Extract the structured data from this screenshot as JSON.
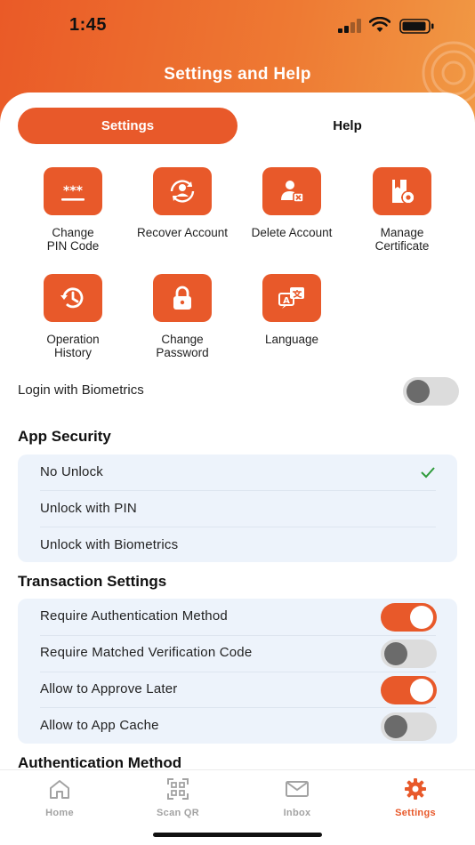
{
  "status_bar": {
    "time": "1:45"
  },
  "header": {
    "title": "Settings and Help"
  },
  "segments": {
    "settings": "Settings",
    "help": "Help"
  },
  "tiles": [
    {
      "label": "Change\nPIN Code",
      "icon": "pin-code-icon"
    },
    {
      "label": "Recover Account",
      "icon": "recover-account-icon"
    },
    {
      "label": "Delete Account",
      "icon": "delete-account-icon"
    },
    {
      "label": "Manage\nCertificate",
      "icon": "certificate-icon"
    },
    {
      "label": "Operation\nHistory",
      "icon": "history-icon"
    },
    {
      "label": "Change\nPassword",
      "icon": "lock-icon"
    },
    {
      "label": "Language",
      "icon": "language-icon"
    }
  ],
  "biometrics": {
    "label": "Login with Biometrics",
    "enabled": false
  },
  "app_security": {
    "title": "App Security",
    "options": [
      {
        "label": "No Unlock",
        "selected": true
      },
      {
        "label": "Unlock with PIN",
        "selected": false
      },
      {
        "label": "Unlock with Biometrics",
        "selected": false
      }
    ]
  },
  "transaction_settings": {
    "title": "Transaction Settings",
    "items": [
      {
        "label": "Require Authentication Method",
        "enabled": true
      },
      {
        "label": "Require Matched Verification Code",
        "enabled": false
      },
      {
        "label": "Allow to Approve Later",
        "enabled": true
      },
      {
        "label": "Allow to App Cache",
        "enabled": false
      }
    ]
  },
  "authentication_method": {
    "title": "Authentication Method"
  },
  "tabbar": {
    "items": [
      {
        "label": "Home",
        "icon": "home-icon",
        "active": false
      },
      {
        "label": "Scan QR",
        "icon": "scan-qr-icon",
        "active": false
      },
      {
        "label": "Inbox",
        "icon": "inbox-icon",
        "active": false
      },
      {
        "label": "Settings",
        "icon": "gear-icon",
        "active": true
      }
    ]
  },
  "colors": {
    "accent": "#e8592a",
    "panel": "#edf3fb",
    "toggle_off": "#dcdcdc",
    "check": "#2e9b3a"
  }
}
